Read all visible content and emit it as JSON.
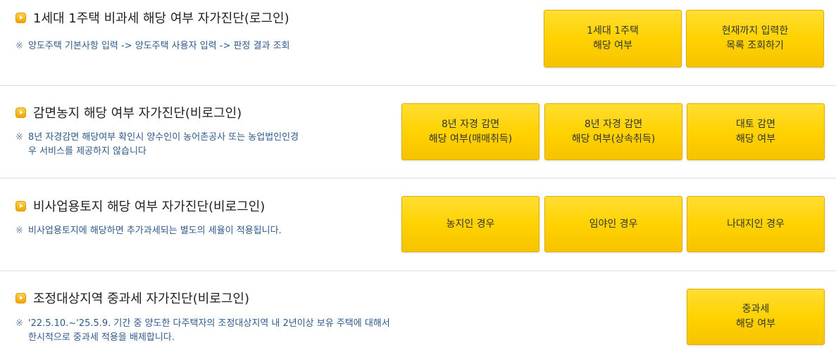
{
  "sections": [
    {
      "title": "1세대 1주택 비과세 해당 여부 자가진단(로그인)",
      "note_mark": "※",
      "note": "양도주택 기본사항 입력 -> 양도주택 사용자 입력 -> 판정 결과 조회",
      "buttons": [
        {
          "label": "1세대 1주택\n해당 여부"
        },
        {
          "label": "현재까지 입력한\n목록 조회하기"
        }
      ]
    },
    {
      "title": "감면농지 해당 여부 자가진단(비로그인)",
      "note_mark": "※",
      "note": "8년 자경감면 해당여부 확인시 양수인이 농어촌공사 또는 농업법인인경\n우 서비스를 제공하지 않습니다",
      "buttons": [
        {
          "label": "8년 자경 감면\n해당 여부(매매취득)"
        },
        {
          "label": "8년 자경 감면\n해당 여부(상속취득)"
        },
        {
          "label": "대토 감면\n해당 여부"
        }
      ]
    },
    {
      "title": "비사업용토지 해당 여부 자가진단(비로그인)",
      "note_mark": "※",
      "note": "비사업용토지에 해당하면 추가과세되는 별도의 세율이 적용됩니다.",
      "buttons": [
        {
          "label": "농지인 경우"
        },
        {
          "label": "임야인 경우"
        },
        {
          "label": "나대지인 경우"
        }
      ]
    },
    {
      "title": "조정대상지역 중과세 자가진단(비로그인)",
      "note_mark": "※",
      "note": "'22.5.10.~'25.5.9. 기간 중 양도한 다주택자의 조정대상지역 내 2년이상 보유 주택에 대해서\n한시적으로 중과세 적용을 배제합니다.",
      "buttons": [
        {
          "label": "중과세\n해당 여부"
        }
      ]
    }
  ],
  "colors": {
    "button_fill": "#ffd200",
    "button_border": "#e0ae00",
    "note_text": "#2e5a8a",
    "bullet": "#f3a300"
  },
  "icons": {
    "section_bullet": "orange-arrow-bullet-icon"
  }
}
